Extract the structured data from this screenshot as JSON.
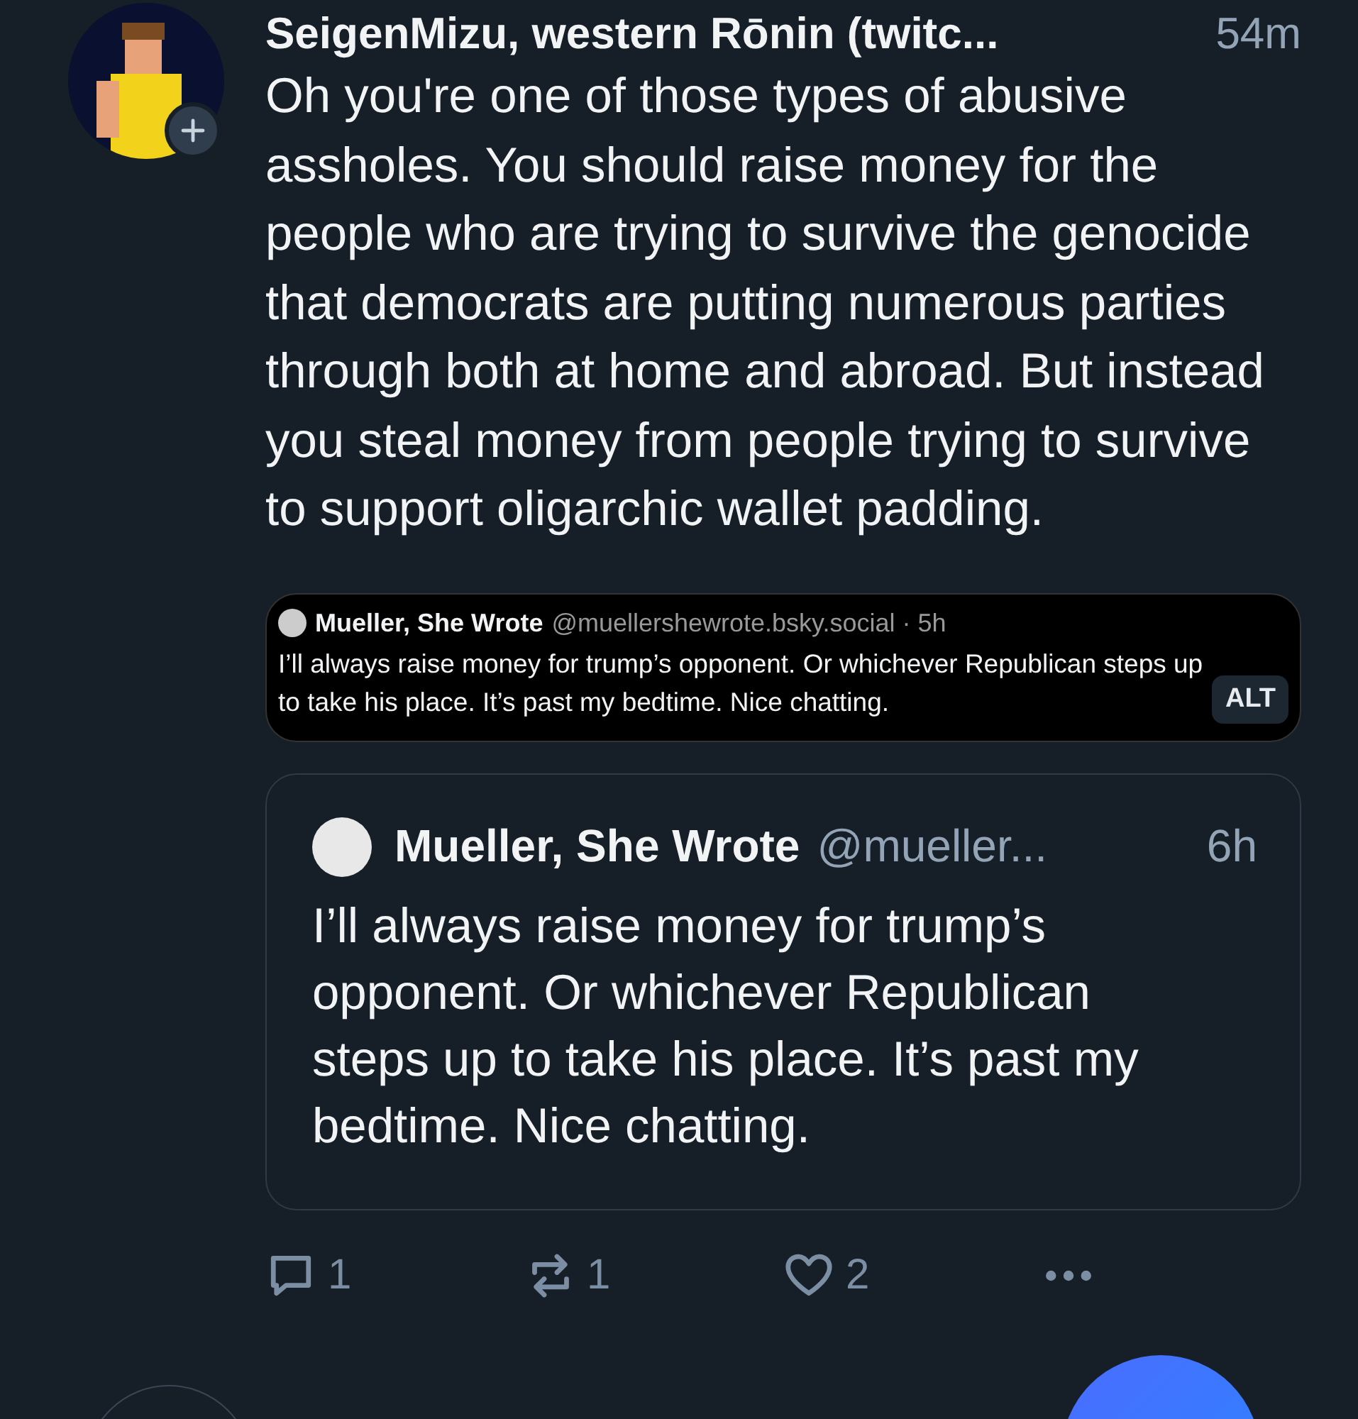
{
  "post": {
    "author": "SeigenMizu, western Rōnin (twitc...",
    "time": "54m",
    "text": "Oh you're one of those types of abusive assholes. You should raise money for the people who are trying to survive the genocide that democrats are putting numerous parties through both at home and abroad. But instead you steal money from people trying to survive to support oligarchic wallet padding.",
    "image": {
      "author": "Mueller, She Wrote",
      "handle": "@muellershewrote.bsky.social · 5h",
      "text": "I’ll always raise money for trump’s opponent. Or whichever Republican steps up to take his place. It’s past my bedtime. Nice chatting.",
      "alt_badge": "ALT"
    },
    "quote": {
      "author": "Mueller, She Wrote",
      "handle": "@mueller...",
      "time": "6h",
      "text": "I’ll always raise money for trump’s opponent. Or whichever Republican steps up to take his place. It’s past my bedtime. Nice chatting."
    },
    "actions": [
      {
        "kind": "reply",
        "count": "1"
      },
      {
        "kind": "repost",
        "count": "1"
      },
      {
        "kind": "like",
        "count": "2"
      },
      {
        "kind": "more"
      }
    ]
  }
}
